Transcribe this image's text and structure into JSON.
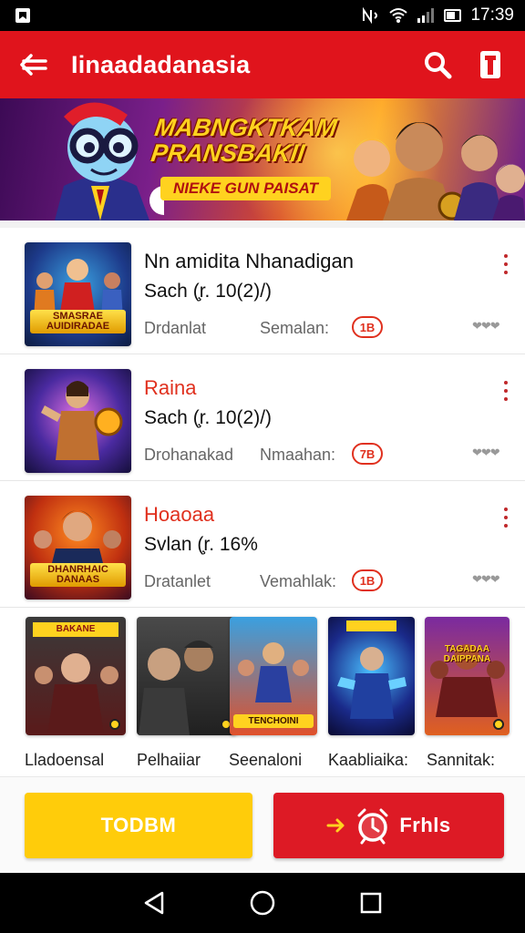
{
  "status_bar": {
    "time": "17:39"
  },
  "app_bar": {
    "title": "Iinaadadanasia"
  },
  "banner": {
    "title_line1": "MABNGKTKAM",
    "title_line2": "PRANSBAKII",
    "ribbon": "NIEKE GUN PAISAT"
  },
  "list": [
    {
      "title": "Nn amidita Nhanadigan",
      "subtitle": "Sach (̧r. 10(2)/)",
      "meta1": "Drdanlat",
      "meta2": "Semalan:",
      "badge": "1B",
      "thumb_caption": "SMASRAE AUIDIRADAE"
    },
    {
      "title": "Raina",
      "subtitle": "Sach (̧r. 10(2)/)",
      "meta1": "Drohanakad",
      "meta2": "Nmaahan:",
      "badge": "7B",
      "thumb_caption": ""
    },
    {
      "title": "Hoaoaa",
      "subtitle": "Svlan (̧r. 16%",
      "meta1": "Dratanlet",
      "meta2": "Vemahlak:",
      "badge": "1B",
      "thumb_caption": "DHANRHAIC DANAAS"
    }
  ],
  "strip": [
    {
      "label": "Lladoensal",
      "caption": "BAKANE"
    },
    {
      "label": "Pelhaiiar",
      "caption": ""
    },
    {
      "label": "Seenaloni",
      "caption": "TENCHOINI"
    },
    {
      "label": "Kaabliaika:",
      "caption": ""
    },
    {
      "label": "Sannitak:",
      "caption": "TAGADAA DAIPPANA"
    }
  ],
  "buttons": {
    "primary": "TODBM",
    "secondary": "Frhls"
  },
  "colors": {
    "accent": "#e0141c",
    "yellow": "#ffcc0a",
    "link": "#e0301e"
  },
  "icons": {
    "back": "back-arrow-icon",
    "search": "search-icon",
    "menu": "menu-icon",
    "alarm": "alarm-clock-icon"
  }
}
